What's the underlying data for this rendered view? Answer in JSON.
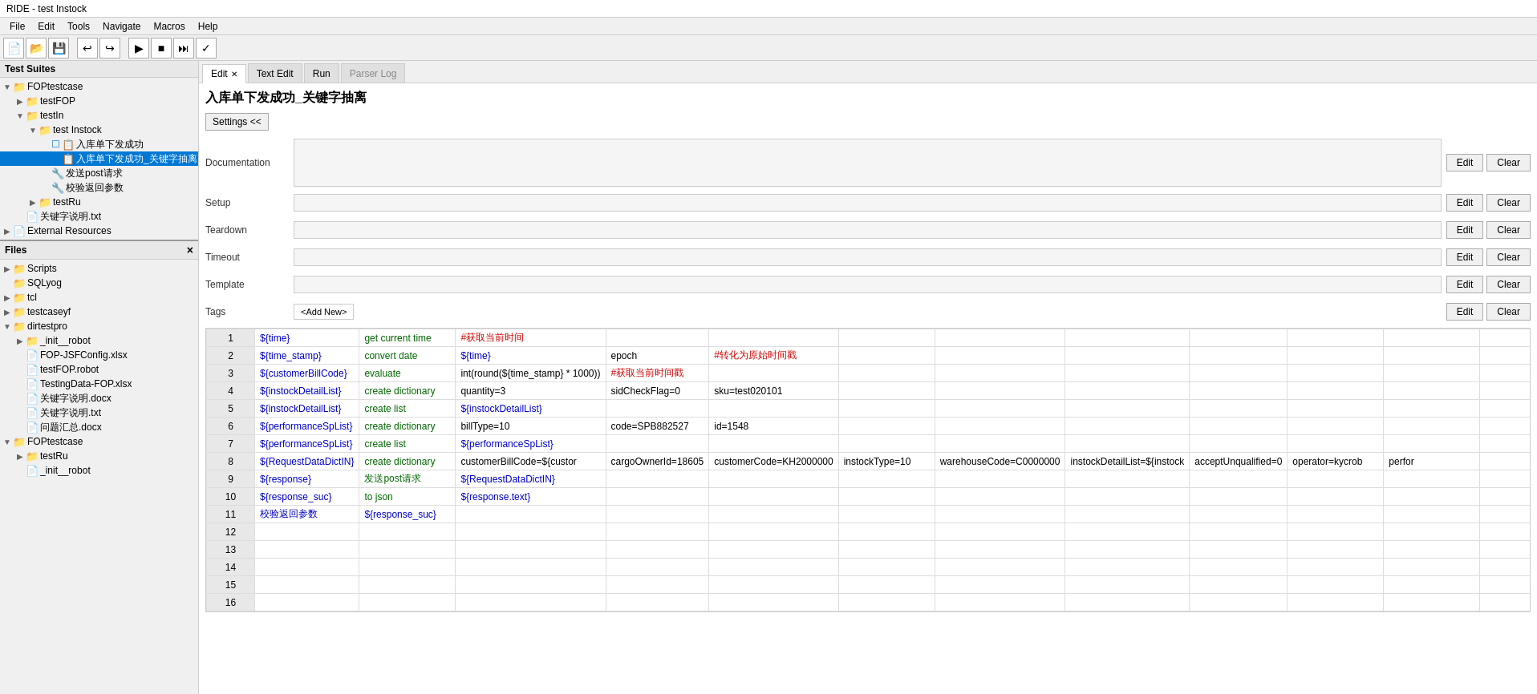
{
  "window": {
    "title": "RIDE - test Instock"
  },
  "menu": {
    "items": [
      "File",
      "Edit",
      "Tools",
      "Navigate",
      "Macros",
      "Help"
    ]
  },
  "tabs": [
    {
      "label": "Edit",
      "active": true,
      "closable": true
    },
    {
      "label": "Text Edit",
      "active": false,
      "closable": false
    },
    {
      "label": "Run",
      "active": false,
      "closable": false
    },
    {
      "label": "Parser Log",
      "active": false,
      "closable": false,
      "faded": true
    }
  ],
  "page": {
    "title": "入库单下发成功_关键字抽离",
    "settings_btn": "Settings <<",
    "doc_label": "Documentation",
    "setup_label": "Setup",
    "teardown_label": "Teardown",
    "timeout_label": "Timeout",
    "template_label": "Template",
    "tags_label": "Tags",
    "add_new_label": "<Add New>",
    "edit_label": "Edit",
    "clear_label": "Clear"
  },
  "left_panel": {
    "test_suites_title": "Test Suites",
    "tree": [
      {
        "level": 0,
        "toggle": "▼",
        "icon": "folder",
        "label": "FOPtestcase",
        "type": "suite"
      },
      {
        "level": 1,
        "toggle": "▶",
        "icon": "folder",
        "label": "testFOP",
        "type": "suite"
      },
      {
        "level": 1,
        "toggle": "▼",
        "icon": "folder",
        "label": "testIn",
        "type": "suite"
      },
      {
        "level": 2,
        "toggle": "▼",
        "icon": "folder",
        "label": "test Instock",
        "type": "suite"
      },
      {
        "level": 3,
        "toggle": "",
        "icon": "test",
        "label": "入库单下发成功",
        "type": "test",
        "checked": false
      },
      {
        "level": 3,
        "toggle": "",
        "icon": "test",
        "label": "入库单下发成功_关键字抽离",
        "type": "test",
        "checked": true,
        "selected": true
      },
      {
        "level": 3,
        "toggle": "",
        "icon": "kw",
        "label": "发送post请求",
        "type": "kw"
      },
      {
        "level": 3,
        "toggle": "",
        "icon": "kw",
        "label": "校验返回参数",
        "type": "kw"
      },
      {
        "level": 2,
        "toggle": "▶",
        "icon": "folder",
        "label": "testRu",
        "type": "suite"
      },
      {
        "level": 1,
        "toggle": "",
        "icon": "file",
        "label": "关键字说明.txt",
        "type": "file"
      },
      {
        "level": 0,
        "toggle": "▶",
        "icon": "folder-ext",
        "label": "External Resources",
        "type": "ext"
      }
    ],
    "files_title": "Files",
    "files_close": "×",
    "files_tree": [
      {
        "level": 0,
        "toggle": "▶",
        "icon": "folder",
        "label": "Scripts",
        "type": "folder"
      },
      {
        "level": 0,
        "toggle": "",
        "icon": "file",
        "label": "SQLyog",
        "type": "folder"
      },
      {
        "level": 0,
        "toggle": "▶",
        "icon": "folder",
        "label": "tcl",
        "type": "folder"
      },
      {
        "level": 0,
        "toggle": "▶",
        "icon": "folder",
        "label": "testcaseyf",
        "type": "folder"
      },
      {
        "level": 0,
        "toggle": "▼",
        "icon": "folder",
        "label": "dirtestpro",
        "type": "folder"
      },
      {
        "level": 1,
        "toggle": "▶",
        "icon": "folder",
        "label": "_init__robot",
        "type": "folder"
      },
      {
        "level": 1,
        "toggle": "",
        "icon": "xls",
        "label": "FOP-JSFConfig.xlsx",
        "type": "file"
      },
      {
        "level": 1,
        "toggle": "",
        "icon": "robot",
        "label": "testFOP.robot",
        "type": "file"
      },
      {
        "level": 1,
        "toggle": "",
        "icon": "xls",
        "label": "TestingData-FOP.xlsx",
        "type": "file"
      },
      {
        "level": 1,
        "toggle": "",
        "icon": "docx",
        "label": "关键字说明.docx",
        "type": "file"
      },
      {
        "level": 1,
        "toggle": "",
        "icon": "txt",
        "label": "关键字说明.txt",
        "type": "file"
      },
      {
        "level": 1,
        "toggle": "",
        "icon": "docx",
        "label": "问题汇总.docx",
        "type": "file"
      },
      {
        "level": 0,
        "toggle": "▼",
        "icon": "folder",
        "label": "FOPtestcase",
        "type": "folder"
      },
      {
        "level": 1,
        "toggle": "▶",
        "icon": "folder",
        "label": "testRu",
        "type": "folder"
      },
      {
        "level": 1,
        "toggle": "",
        "icon": "robot",
        "label": "_init__robot",
        "type": "file"
      }
    ]
  },
  "table": {
    "rows": [
      {
        "num": "1",
        "cells": [
          "${time}",
          "get current time",
          "#获取当前时间",
          "",
          "",
          "",
          "",
          "",
          "",
          "",
          "",
          ""
        ]
      },
      {
        "num": "2",
        "cells": [
          "${time_stamp}",
          "convert date",
          "${time}",
          "epoch",
          "#转化为原始时间戳",
          "",
          "",
          "",
          "",
          "",
          "",
          ""
        ]
      },
      {
        "num": "3",
        "cells": [
          "${customerBillCode}",
          "evaluate",
          "int(round(${time_stamp} * 1000))",
          "#获取当前时间戳",
          "",
          "",
          "",
          "",
          "",
          "",
          "",
          ""
        ]
      },
      {
        "num": "4",
        "cells": [
          "${instockDetailList}",
          "create dictionary",
          "quantity=3",
          "sidCheckFlag=0",
          "sku=test020101",
          "",
          "",
          "",
          "",
          "",
          "",
          ""
        ]
      },
      {
        "num": "5",
        "cells": [
          "${instockDetailList}",
          "create list",
          "${instockDetailList}",
          "",
          "",
          "",
          "",
          "",
          "",
          "",
          "",
          ""
        ]
      },
      {
        "num": "6",
        "cells": [
          "${performanceSpList}",
          "create dictionary",
          "billType=10",
          "code=SPB882527",
          "id=1548",
          "",
          "",
          "",
          "",
          "",
          "",
          ""
        ]
      },
      {
        "num": "7",
        "cells": [
          "${performanceSpList}",
          "create list",
          "${performanceSpList}",
          "",
          "",
          "",
          "",
          "",
          "",
          "",
          "",
          ""
        ]
      },
      {
        "num": "8",
        "cells": [
          "${RequestDataDictIN}",
          "create dictionary",
          "customerBillCode=${custor",
          "cargoOwnerId=18605",
          "customerCode=KH2000000",
          "instockType=10",
          "warehouseCode=C0000000",
          "instockDetailList=${instock",
          "acceptUnqualified=0",
          "operator=kycrob",
          "perfor",
          ""
        ]
      },
      {
        "num": "9",
        "cells": [
          "${response}",
          "发送post请求",
          "${RequestDataDictIN}",
          "",
          "",
          "",
          "",
          "",
          "",
          "",
          "",
          ""
        ]
      },
      {
        "num": "10",
        "cells": [
          "${response_suc}",
          "to json",
          "${response.text}",
          "",
          "",
          "",
          "",
          "",
          "",
          "",
          "",
          ""
        ]
      },
      {
        "num": "11",
        "cells": [
          "校验返回参数",
          "${response_suc}",
          "",
          "",
          "",
          "",
          "",
          "",
          "",
          "",
          "",
          ""
        ]
      },
      {
        "num": "12",
        "cells": [
          "",
          "",
          "",
          "",
          "",
          "",
          "",
          "",
          "",
          "",
          "",
          ""
        ]
      },
      {
        "num": "13",
        "cells": [
          "",
          "",
          "",
          "",
          "",
          "",
          "",
          "",
          "",
          "",
          "",
          ""
        ]
      },
      {
        "num": "14",
        "cells": [
          "",
          "",
          "",
          "",
          "",
          "",
          "",
          "",
          "",
          "",
          "",
          ""
        ]
      },
      {
        "num": "15",
        "cells": [
          "",
          "",
          "",
          "",
          "",
          "",
          "",
          "",
          "",
          "",
          "",
          ""
        ]
      },
      {
        "num": "16",
        "cells": [
          "",
          "",
          "",
          "",
          "",
          "",
          "",
          "",
          "",
          "",
          "",
          ""
        ]
      }
    ]
  }
}
